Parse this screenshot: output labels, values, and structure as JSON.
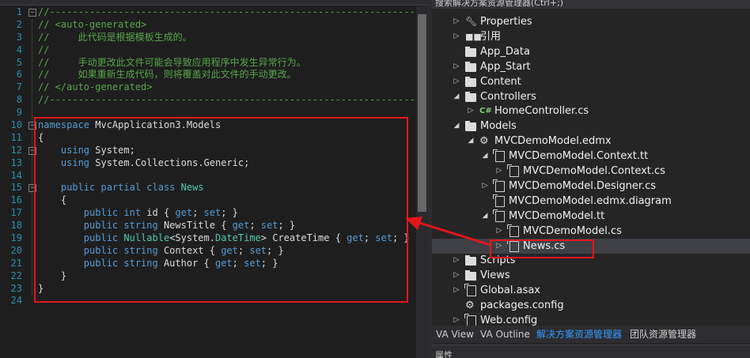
{
  "editor": {
    "lines": [
      {
        "n": "1",
        "fold": "−",
        "segs": [
          {
            "c": "c",
            "t": "//"
          },
          {
            "c": "dash",
            "t": "--------------------------------------------------------------------------------"
          }
        ]
      },
      {
        "n": "2",
        "segs": [
          {
            "c": "c",
            "t": "// <auto-generated>"
          }
        ]
      },
      {
        "n": "3",
        "segs": [
          {
            "c": "c",
            "t": "//     此代码是根据模板生成的。"
          }
        ]
      },
      {
        "n": "4",
        "segs": [
          {
            "c": "c",
            "t": "//"
          }
        ]
      },
      {
        "n": "5",
        "segs": [
          {
            "c": "c",
            "t": "//     手动更改此文件可能会导致应用程序中发生异常行为。"
          }
        ]
      },
      {
        "n": "6",
        "segs": [
          {
            "c": "c",
            "t": "//     如果重新生成代码，则将覆盖对此文件的手动更改。"
          }
        ]
      },
      {
        "n": "7",
        "segs": [
          {
            "c": "c",
            "t": "// </auto-generated>"
          }
        ]
      },
      {
        "n": "8",
        "segs": [
          {
            "c": "c",
            "t": "//"
          },
          {
            "c": "dash",
            "t": "--------------------------------------------------------------------------------"
          }
        ]
      },
      {
        "n": "9",
        "segs": []
      },
      {
        "n": "10",
        "fold": "−",
        "segs": [
          {
            "c": "k",
            "t": "namespace"
          },
          {
            "c": "n",
            "t": " MvcApplication3.Models"
          }
        ]
      },
      {
        "n": "11",
        "segs": [
          {
            "c": "n",
            "t": "{"
          }
        ]
      },
      {
        "n": "12",
        "fold": "−",
        "segs": [
          {
            "c": "n",
            "t": "    "
          },
          {
            "c": "k",
            "t": "using"
          },
          {
            "c": "n",
            "t": " System;"
          }
        ]
      },
      {
        "n": "13",
        "segs": [
          {
            "c": "n",
            "t": "    "
          },
          {
            "c": "k",
            "t": "using"
          },
          {
            "c": "n",
            "t": " System.Collections.Generic;"
          }
        ]
      },
      {
        "n": "14",
        "segs": []
      },
      {
        "n": "15",
        "fold": "−",
        "segs": [
          {
            "c": "n",
            "t": "    "
          },
          {
            "c": "k",
            "t": "public partial class"
          },
          {
            "c": "n",
            "t": " "
          },
          {
            "c": "t",
            "t": "News"
          }
        ]
      },
      {
        "n": "16",
        "segs": [
          {
            "c": "n",
            "t": "    {"
          }
        ]
      },
      {
        "n": "17",
        "segs": [
          {
            "c": "n",
            "t": "        "
          },
          {
            "c": "k",
            "t": "public int"
          },
          {
            "c": "n",
            "t": " id { "
          },
          {
            "c": "k",
            "t": "get"
          },
          {
            "c": "n",
            "t": "; "
          },
          {
            "c": "k",
            "t": "set"
          },
          {
            "c": "n",
            "t": "; }"
          }
        ]
      },
      {
        "n": "18",
        "segs": [
          {
            "c": "n",
            "t": "        "
          },
          {
            "c": "k",
            "t": "public string"
          },
          {
            "c": "n",
            "t": " NewsTitle { "
          },
          {
            "c": "k",
            "t": "get"
          },
          {
            "c": "n",
            "t": "; "
          },
          {
            "c": "k",
            "t": "set"
          },
          {
            "c": "n",
            "t": "; }"
          }
        ]
      },
      {
        "n": "19",
        "segs": [
          {
            "c": "n",
            "t": "        "
          },
          {
            "c": "k",
            "t": "public"
          },
          {
            "c": "n",
            "t": " "
          },
          {
            "c": "t",
            "t": "Nullable"
          },
          {
            "c": "n",
            "t": "<System."
          },
          {
            "c": "t",
            "t": "DateTime"
          },
          {
            "c": "n",
            "t": "> CreateTime { "
          },
          {
            "c": "k",
            "t": "get"
          },
          {
            "c": "n",
            "t": "; "
          },
          {
            "c": "k",
            "t": "set"
          },
          {
            "c": "n",
            "t": "; }"
          }
        ]
      },
      {
        "n": "20",
        "segs": [
          {
            "c": "n",
            "t": "        "
          },
          {
            "c": "k",
            "t": "public string"
          },
          {
            "c": "n",
            "t": " Context { "
          },
          {
            "c": "k",
            "t": "get"
          },
          {
            "c": "n",
            "t": "; "
          },
          {
            "c": "k",
            "t": "set"
          },
          {
            "c": "n",
            "t": "; }"
          }
        ]
      },
      {
        "n": "21",
        "segs": [
          {
            "c": "n",
            "t": "        "
          },
          {
            "c": "k",
            "t": "public string"
          },
          {
            "c": "n",
            "t": " Author { "
          },
          {
            "c": "k",
            "t": "get"
          },
          {
            "c": "n",
            "t": "; "
          },
          {
            "c": "k",
            "t": "set"
          },
          {
            "c": "n",
            "t": "; }"
          }
        ]
      },
      {
        "n": "22",
        "segs": [
          {
            "c": "n",
            "t": "    }"
          }
        ]
      },
      {
        "n": "23",
        "segs": [
          {
            "c": "n",
            "t": "}"
          }
        ]
      },
      {
        "n": "24",
        "segs": []
      }
    ]
  },
  "explorer": {
    "search_text": "搜索解决方案资源管理器(Ctrl+;)",
    "items": [
      {
        "label": "Properties",
        "icon": "wrench-icon",
        "depth": 1,
        "exp": "▷"
      },
      {
        "label": "引用",
        "icon": "references-icon",
        "depth": 1,
        "exp": "▷"
      },
      {
        "label": "App_Data",
        "icon": "folder-icon",
        "depth": 1,
        "exp": ""
      },
      {
        "label": "App_Start",
        "icon": "folder-icon",
        "depth": 1,
        "exp": "▷"
      },
      {
        "label": "Content",
        "icon": "folder-icon",
        "depth": 1,
        "exp": "▷"
      },
      {
        "label": "Controllers",
        "icon": "folder-icon",
        "depth": 1,
        "exp": "◢"
      },
      {
        "label": "HomeController.cs",
        "icon": "csharp-file-icon",
        "depth": 2,
        "exp": "▷"
      },
      {
        "label": "Models",
        "icon": "folder-icon",
        "depth": 1,
        "exp": "◢"
      },
      {
        "label": "MVCDemoModel.edmx",
        "icon": "edmx-icon",
        "depth": 2,
        "exp": "◢"
      },
      {
        "label": "MVCDemoModel.Context.tt",
        "icon": "file-icon",
        "depth": 3,
        "exp": "◢"
      },
      {
        "label": "MVCDemoModel.Context.cs",
        "icon": "file-icon",
        "depth": 4,
        "exp": "▷"
      },
      {
        "label": "MVCDemoModel.Designer.cs",
        "icon": "file-icon",
        "depth": 3,
        "exp": "▷"
      },
      {
        "label": "MVCDemoModel.edmx.diagram",
        "icon": "file-icon",
        "depth": 3,
        "exp": ""
      },
      {
        "label": "MVCDemoModel.tt",
        "icon": "file-icon",
        "depth": 3,
        "exp": "◢"
      },
      {
        "label": "MVCDemoModel.cs",
        "icon": "file-icon",
        "depth": 4,
        "exp": "▷"
      },
      {
        "label": "News.cs",
        "icon": "file-icon",
        "depth": 4,
        "exp": "▷",
        "selected": true
      },
      {
        "label": "Scripts",
        "icon": "folder-icon",
        "depth": 1,
        "exp": "▷"
      },
      {
        "label": "Views",
        "icon": "folder-icon",
        "depth": 1,
        "exp": "▷"
      },
      {
        "label": "Global.asax",
        "icon": "file-icon",
        "depth": 1,
        "exp": "▷"
      },
      {
        "label": "packages.config",
        "icon": "config-icon",
        "depth": 1,
        "exp": ""
      },
      {
        "label": "Web.config",
        "icon": "file-icon",
        "depth": 1,
        "exp": "▷"
      }
    ],
    "tabs": [
      {
        "label": "VA View",
        "active": false
      },
      {
        "label": "VA Outline",
        "active": false
      },
      {
        "label": "解决方案资源管理器",
        "active": true
      },
      {
        "label": "团队资源管理器",
        "active": false
      }
    ],
    "properties_label": "属性"
  },
  "colors": {
    "highlight": "#e3161b",
    "active_tab": "#3399ff",
    "comment": "#57a64a",
    "keyword": "#569cd6",
    "type": "#4ec9b0"
  }
}
